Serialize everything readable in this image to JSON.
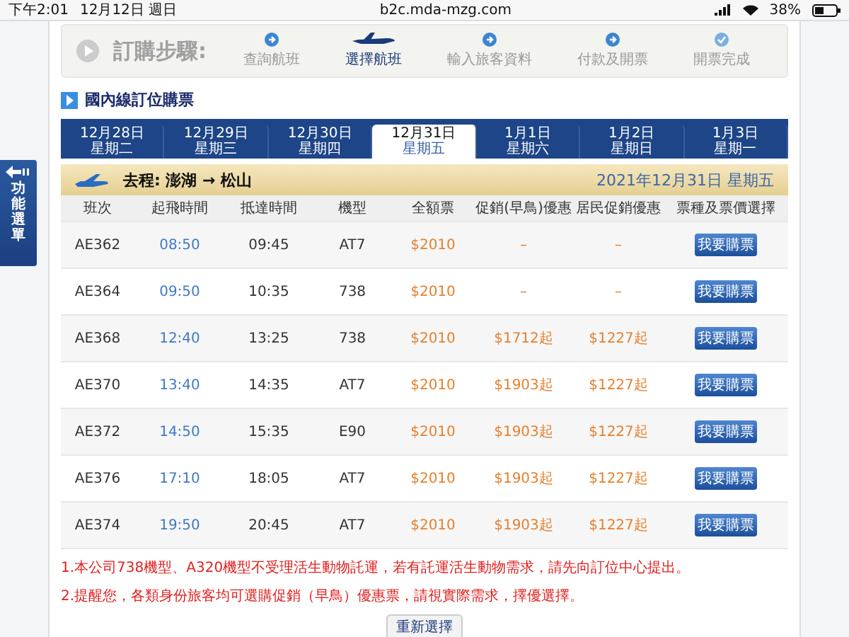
{
  "status_bar": {
    "time": "下午2:01",
    "date": "12月12日 週日",
    "url": "b2c.mda-mzg.com",
    "battery": "38%"
  },
  "side_menu": {
    "label": "功能選單"
  },
  "steps": {
    "title": "訂購步驟:",
    "items": [
      {
        "label": "查詢航班",
        "selected": false
      },
      {
        "label": "選擇航班",
        "selected": true
      },
      {
        "label": "輸入旅客資料",
        "selected": false
      },
      {
        "label": "付款及開票",
        "selected": false
      },
      {
        "label": "開票完成",
        "selected": false
      }
    ]
  },
  "section_title": "國內線訂位購票",
  "date_tabs": [
    {
      "date": "12月28日",
      "weekday": "星期二",
      "selected": false
    },
    {
      "date": "12月29日",
      "weekday": "星期三",
      "selected": false
    },
    {
      "date": "12月30日",
      "weekday": "星期四",
      "selected": false
    },
    {
      "date": "12月31日",
      "weekday": "星期五",
      "selected": true
    },
    {
      "date": "1月1日",
      "weekday": "星期六",
      "selected": false
    },
    {
      "date": "1月2日",
      "weekday": "星期日",
      "selected": false
    },
    {
      "date": "1月3日",
      "weekday": "星期一",
      "selected": false
    }
  ],
  "route": {
    "label": "去程: 澎湖 → 松山",
    "date": "2021年12月31日 星期五"
  },
  "table": {
    "columns": [
      "班次",
      "起飛時間",
      "抵達時間",
      "機型",
      "全額票",
      "促銷(早鳥)優惠",
      "居民促銷優惠",
      "票種及票價選擇"
    ],
    "rows": [
      {
        "flight": "AE362",
        "depart": "08:50",
        "arrive": "09:45",
        "aircraft": "AT7",
        "full": "$2010",
        "early": "–",
        "resident": "–",
        "action": "我要購票"
      },
      {
        "flight": "AE364",
        "depart": "09:50",
        "arrive": "10:35",
        "aircraft": "738",
        "full": "$2010",
        "early": "–",
        "resident": "–",
        "action": "我要購票"
      },
      {
        "flight": "AE368",
        "depart": "12:40",
        "arrive": "13:25",
        "aircraft": "738",
        "full": "$2010",
        "early": "$1712起",
        "resident": "$1227起",
        "action": "我要購票"
      },
      {
        "flight": "AE370",
        "depart": "13:40",
        "arrive": "14:35",
        "aircraft": "AT7",
        "full": "$2010",
        "early": "$1903起",
        "resident": "$1227起",
        "action": "我要購票"
      },
      {
        "flight": "AE372",
        "depart": "14:50",
        "arrive": "15:35",
        "aircraft": "E90",
        "full": "$2010",
        "early": "$1903起",
        "resident": "$1227起",
        "action": "我要購票"
      },
      {
        "flight": "AE376",
        "depart": "17:10",
        "arrive": "18:05",
        "aircraft": "AT7",
        "full": "$2010",
        "early": "$1903起",
        "resident": "$1227起",
        "action": "我要購票"
      },
      {
        "flight": "AE374",
        "depart": "19:50",
        "arrive": "20:45",
        "aircraft": "AT7",
        "full": "$2010",
        "early": "$1903起",
        "resident": "$1227起",
        "action": "我要購票"
      }
    ]
  },
  "notes": [
    "1.本公司738機型、A320機型不受理活生動物託運，若有託運活生動物需求，請先向訂位中心提出。",
    "2.提醒您，各類身份旅客均可選購促銷（早鳥）優惠票，請視實際需求，擇優選擇。"
  ],
  "reset_button": "重新選擇"
}
